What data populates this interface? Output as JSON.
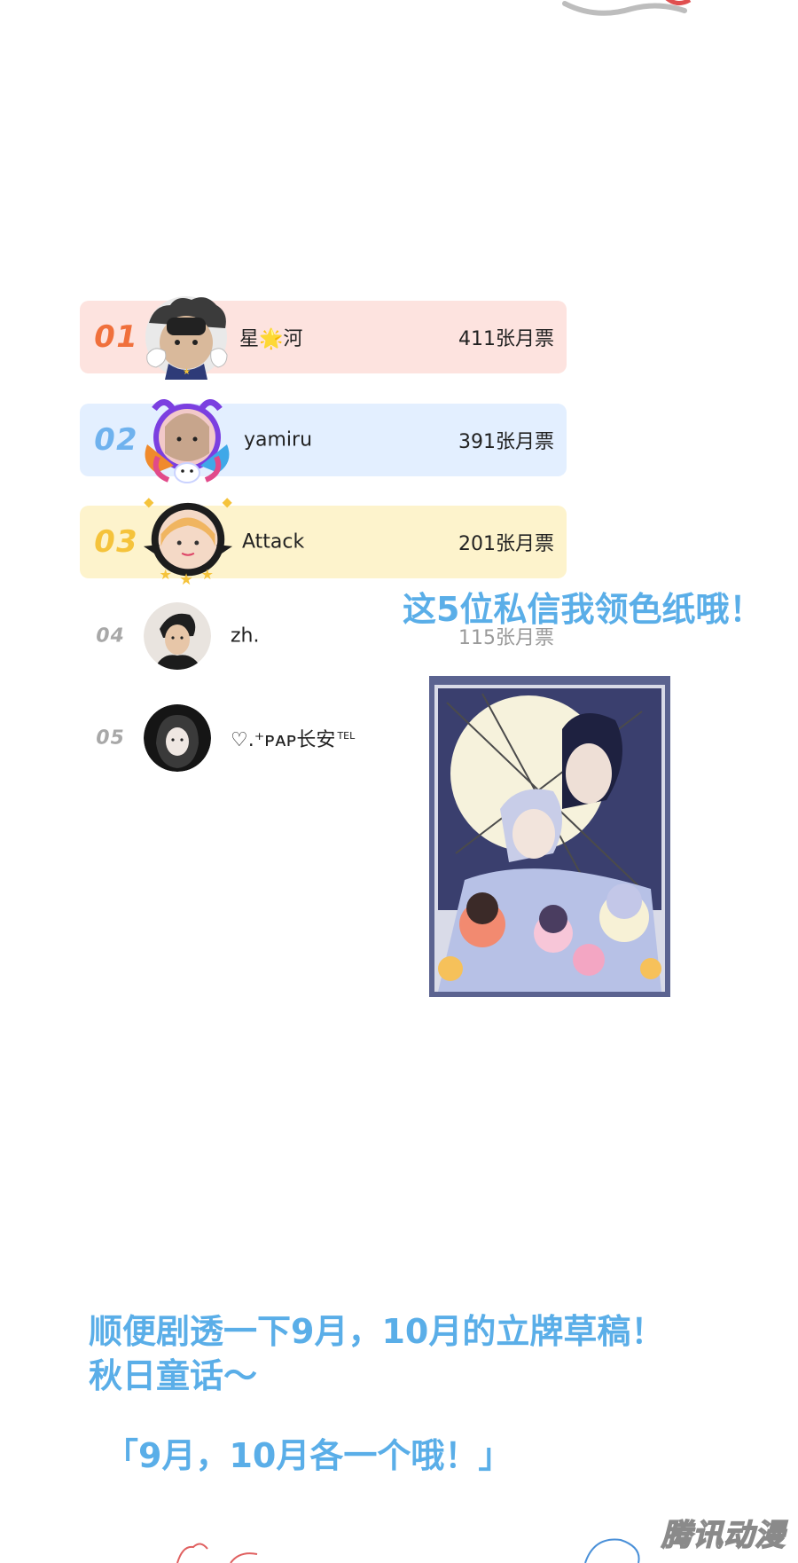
{
  "ranking": [
    {
      "rank": "01",
      "name": "星🌟河",
      "votes": "411张月票",
      "bg": "#fde3df",
      "num_color": "#f0703c",
      "frame": "clouds"
    },
    {
      "rank": "02",
      "name": "yamiru",
      "votes": "391张月票",
      "bg": "#e3efff",
      "num_color": "#6fb2ee",
      "frame": "dragon"
    },
    {
      "rank": "03",
      "name": "Attack",
      "votes": "201张月票",
      "bg": "#fdf3cc",
      "num_color": "#f5c33b",
      "frame": "stars"
    },
    {
      "rank": "04",
      "name": "zh.",
      "votes": "115张月票"
    },
    {
      "rank": "05",
      "name": "♡.⁺ᴘᴀᴘ长安",
      "name_sup": "TEL"
    }
  ],
  "callout": "这5位私信我领色纸哦！",
  "spoiler_lines": [
    "顺便剧透一下9月，10月的立牌草稿！",
    "秋日童话～"
  ],
  "spoiler_note": "「9月，10月各一个哦！」",
  "watermark": "腾讯动漫",
  "colors": {
    "accent_blue": "#5aaee8"
  }
}
